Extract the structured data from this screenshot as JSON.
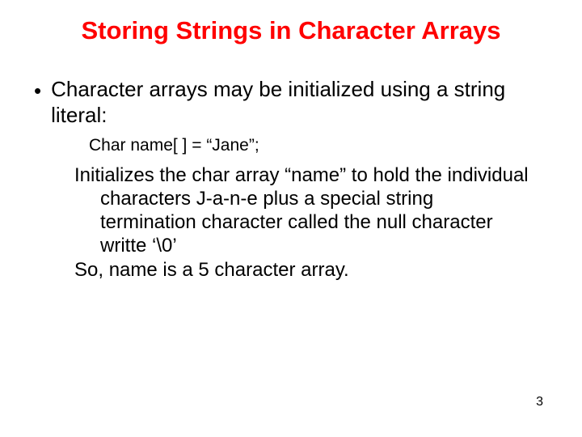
{
  "title": "Storing Strings in Character Arrays",
  "bullet1": "Character arrays may be initialized using a string literal:",
  "code": "Char name[ ] =  “Jane”;",
  "para_block": "Initializes the char array “name” to hold the individual characters J-a-n-e plus a special string termination character called the null character writte ‘\\0’",
  "so_line": "So, name is a 5 character array.",
  "page_number": "3"
}
